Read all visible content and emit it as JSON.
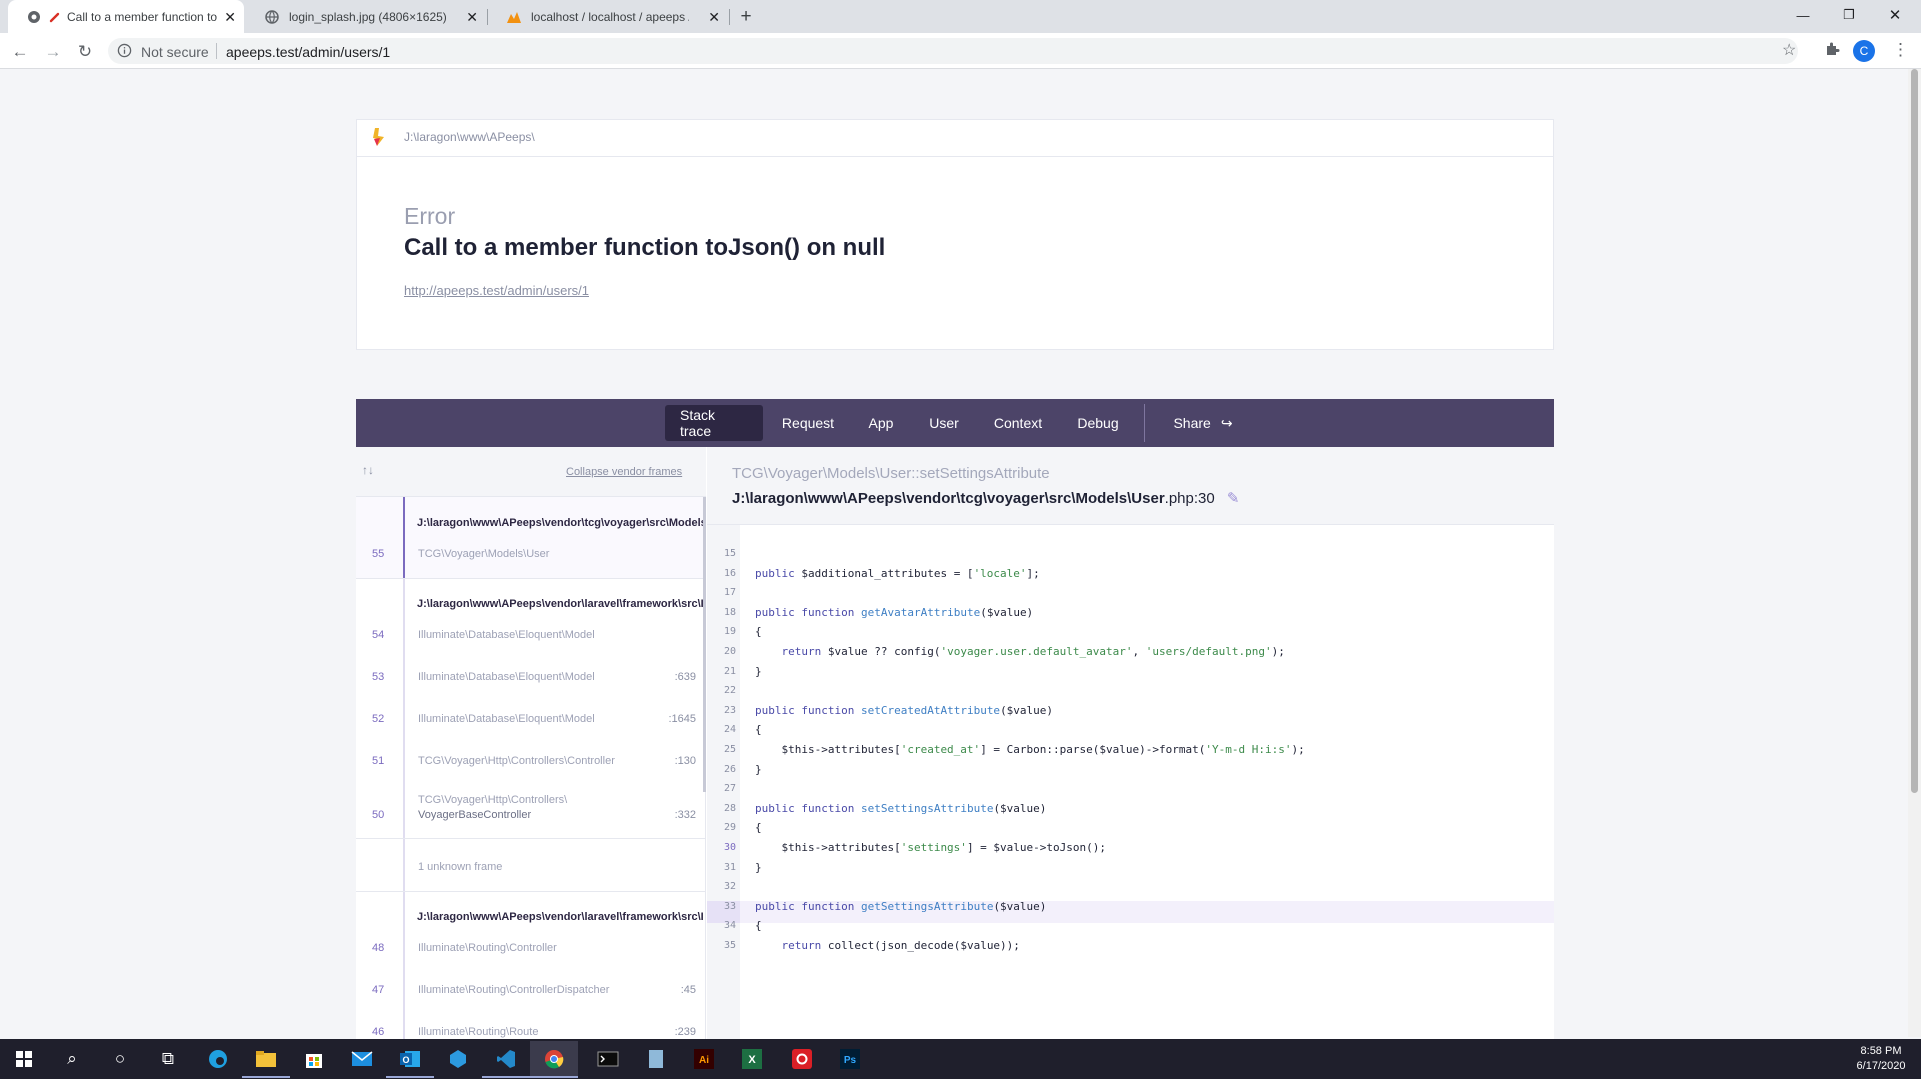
{
  "browser": {
    "tabs": [
      {
        "title": "Call to a member function toJson",
        "icon": "ignition-icon"
      },
      {
        "title": "login_splash.jpg (4806×1625)",
        "icon": "globe-icon"
      },
      {
        "title": "localhost / localhost / apeeps / u",
        "icon": "phpmyadmin-icon"
      }
    ],
    "security_label": "Not secure",
    "url": "apeeps.test/admin/users/1",
    "profile_initial": "C"
  },
  "error": {
    "project_path": "J:\\laragon\\www\\APeeps\\",
    "label": "Error",
    "message": "Call to a member function toJson() on null",
    "url": "http://apeeps.test/admin/users/1"
  },
  "tabs": [
    "Stack trace",
    "Request",
    "App",
    "User",
    "Context",
    "Debug",
    "Share"
  ],
  "frames_header": {
    "collapse_label": "Collapse vendor frames"
  },
  "frame_groups": [
    {
      "file": "J:\\laragon\\www\\APeeps\\vendor\\tcg\\voyager\\src\\Models\\User.php",
      "frames": [
        {
          "num": "55",
          "class": "TCG\\Voyager\\Models\\User",
          "line": ""
        }
      ]
    },
    {
      "file": "J:\\laragon\\www\\APeeps\\vendor\\laravel\\framework\\src\\Illuminate",
      "frames": [
        {
          "num": "54",
          "class": "Illuminate\\Database\\Eloquent\\Model",
          "line": ""
        },
        {
          "num": "53",
          "class": "Illuminate\\Database\\Eloquent\\Model",
          "line": ":639"
        },
        {
          "num": "52",
          "class": "Illuminate\\Database\\Eloquent\\Model",
          "line": ":1645"
        },
        {
          "num": "51",
          "class": "TCG\\Voyager\\Http\\Controllers\\Controller",
          "line": ":130"
        },
        {
          "num": "50",
          "class": "TCG\\Voyager\\Http\\Controllers\\",
          "class2": "VoyagerBaseController",
          "line": ":332"
        }
      ]
    },
    {
      "unknown": "1 unknown frame"
    },
    {
      "file": "J:\\laragon\\www\\APeeps\\vendor\\laravel\\framework\\src\\Illuminate",
      "frames": [
        {
          "num": "48",
          "class": "Illuminate\\Routing\\Controller",
          "line": ""
        },
        {
          "num": "47",
          "class": "Illuminate\\Routing\\ControllerDispatcher",
          "line": ":45"
        },
        {
          "num": "46",
          "class": "Illuminate\\Routing\\Route",
          "line": ":239"
        }
      ]
    }
  ],
  "source": {
    "class": "TCG\\Voyager\\Models\\User",
    "method": "::setSettingsAttribute",
    "file_path": "J:\\laragon\\www\\APeeps\\vendor\\tcg\\voyager\\src\\Models\\",
    "file_name": "User",
    "file_ext": ".php:30",
    "highlight_line": "30",
    "lines": [
      {
        "n": "15",
        "code": ""
      },
      {
        "n": "16",
        "code": "public $additional_attributes = ['locale'];"
      },
      {
        "n": "17",
        "code": ""
      },
      {
        "n": "18",
        "code": "public function getAvatarAttribute($value)"
      },
      {
        "n": "19",
        "code": "{"
      },
      {
        "n": "20",
        "code": "    return $value ?? config('voyager.user.default_avatar', 'users/default.png');"
      },
      {
        "n": "21",
        "code": "}"
      },
      {
        "n": "22",
        "code": ""
      },
      {
        "n": "23",
        "code": "public function setCreatedAtAttribute($value)"
      },
      {
        "n": "24",
        "code": "{"
      },
      {
        "n": "25",
        "code": "    $this->attributes['created_at'] = Carbon::parse($value)->format('Y-m-d H:i:s');"
      },
      {
        "n": "26",
        "code": "}"
      },
      {
        "n": "27",
        "code": ""
      },
      {
        "n": "28",
        "code": "public function setSettingsAttribute($value)"
      },
      {
        "n": "29",
        "code": "{"
      },
      {
        "n": "30",
        "code": "    $this->attributes['settings'] = $value->toJson();"
      },
      {
        "n": "31",
        "code": "}"
      },
      {
        "n": "32",
        "code": ""
      },
      {
        "n": "33",
        "code": "public function getSettingsAttribute($value)"
      },
      {
        "n": "34",
        "code": "{"
      },
      {
        "n": "35",
        "code": "    return collect(json_decode($value));"
      }
    ]
  },
  "taskbar": {
    "time": "8:58 PM",
    "date": "6/17/2020"
  }
}
